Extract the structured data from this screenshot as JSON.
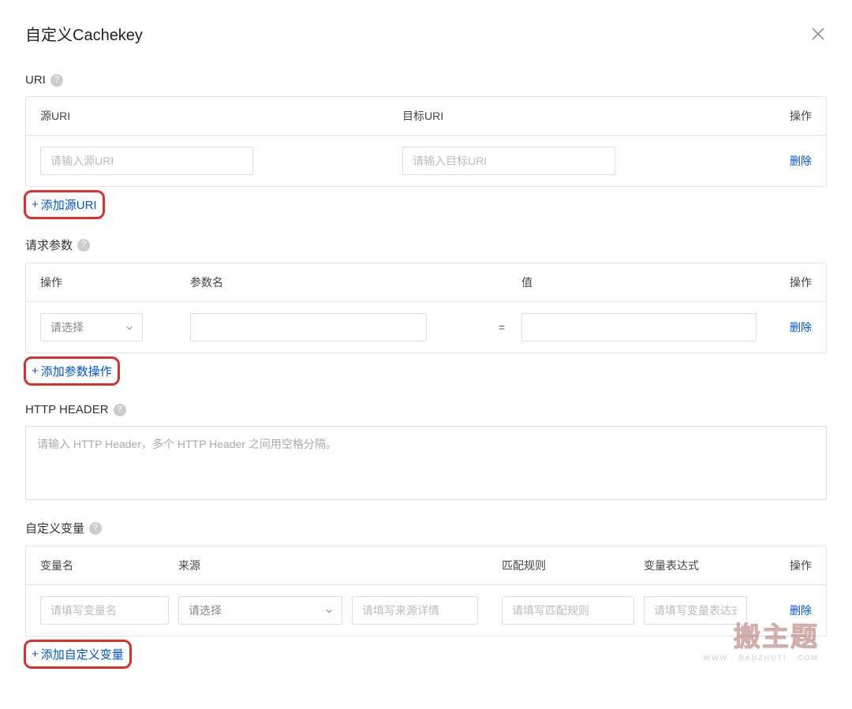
{
  "header": {
    "title": "自定义Cachekey"
  },
  "uri": {
    "label": "URI",
    "columns": {
      "source": "源URI",
      "target": "目标URI",
      "action": "操作"
    },
    "row": {
      "source_placeholder": "请输入源URI",
      "target_placeholder": "请输入目标URI",
      "delete": "删除"
    },
    "add": "添加源URI"
  },
  "params": {
    "label": "请求参数",
    "columns": {
      "op": "操作",
      "name": "参数名",
      "value": "值",
      "action": "操作"
    },
    "row": {
      "select_placeholder": "请选择",
      "eq": "=",
      "name_placeholder": "",
      "value_placeholder": "",
      "delete": "删除"
    },
    "add": "添加参数操作"
  },
  "http_header": {
    "label": "HTTP HEADER",
    "placeholder": "请输入 HTTP Header，多个 HTTP Header 之间用空格分隔。"
  },
  "custom_var": {
    "label": "自定义变量",
    "columns": {
      "name": "变量名",
      "source": "来源",
      "rule": "匹配规则",
      "expr": "变量表达式",
      "action": "操作"
    },
    "row": {
      "name_placeholder": "请填写变量名",
      "source_placeholder": "请选择",
      "source_detail_placeholder": "请填写来源详情",
      "rule_placeholder": "请填写匹配规则",
      "expr_placeholder": "请填写变量表达式",
      "delete": "删除"
    },
    "add": "添加自定义变量"
  },
  "glyphs": {
    "plus": "+"
  },
  "watermark": {
    "big": "搬主题",
    "small": "WWW . BANZHUTI . COM"
  }
}
